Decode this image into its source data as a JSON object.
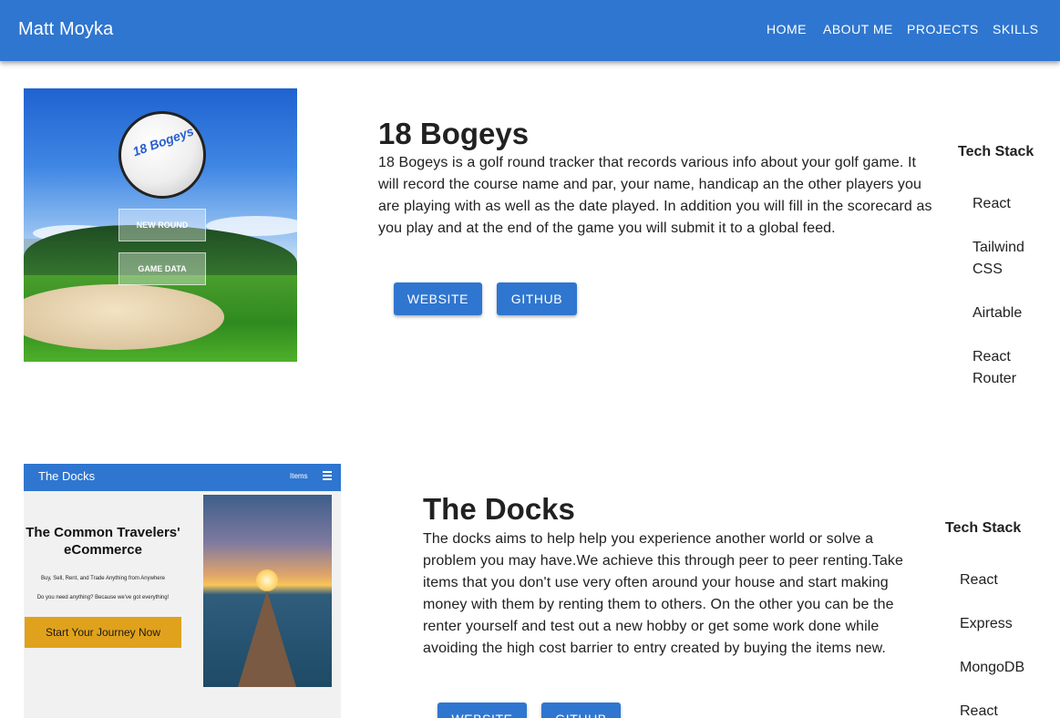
{
  "header": {
    "brand": "Matt Moyka",
    "nav": [
      "HOME",
      "ABOUT ME",
      "PROJECTS",
      "SKILLS"
    ]
  },
  "projects": [
    {
      "title": "18 Bogeys",
      "description": "18 Bogeys is a golf round tracker that records various info about your golf game. It will record the course name and par, your name, handicap an the other players you are playing with as well as the date played. In addition you will fill in the scorecard as you play and at the end of the game you will submit it to a global feed.",
      "buttons": [
        "WEBSITE",
        "GITHUB"
      ],
      "tech_stack_heading": "Tech Stack",
      "tech_stack": [
        "React",
        "Tailwind CSS",
        "Airtable",
        "React Router"
      ],
      "image": {
        "ball_text": "18 Bogeys",
        "buttons": [
          "NEW ROUND",
          "GAME DATA"
        ]
      }
    },
    {
      "title": "The Docks",
      "description": "The docks aims to help help you experience another world or solve a problem you may have.We achieve this through peer to peer renting.Take items that you don't use very often around your house and start making money with them by renting them to others. On the other you can be the renter yourself and test out a new hobby or get some work done while avoiding the high cost barrier to entry created by buying the items new.",
      "buttons": [
        "WEBSITE",
        "GITHUB"
      ],
      "tech_stack_heading": "Tech Stack",
      "tech_stack": [
        "React",
        "Express",
        "MongoDB",
        "React"
      ],
      "image": {
        "logo": "The Docks",
        "menu_label": "Items",
        "headline": "The Common Travelers' eCommerce",
        "subline1": "Buy, Sell, Rent, and Trade Anything from Anywhere",
        "subline2": "Do you need anything? Because we've got everything!",
        "cta": "Start Your Journey Now"
      }
    }
  ],
  "colors": {
    "primary": "#2f76d0",
    "text": "#212121",
    "cta": "#e0a21c"
  }
}
